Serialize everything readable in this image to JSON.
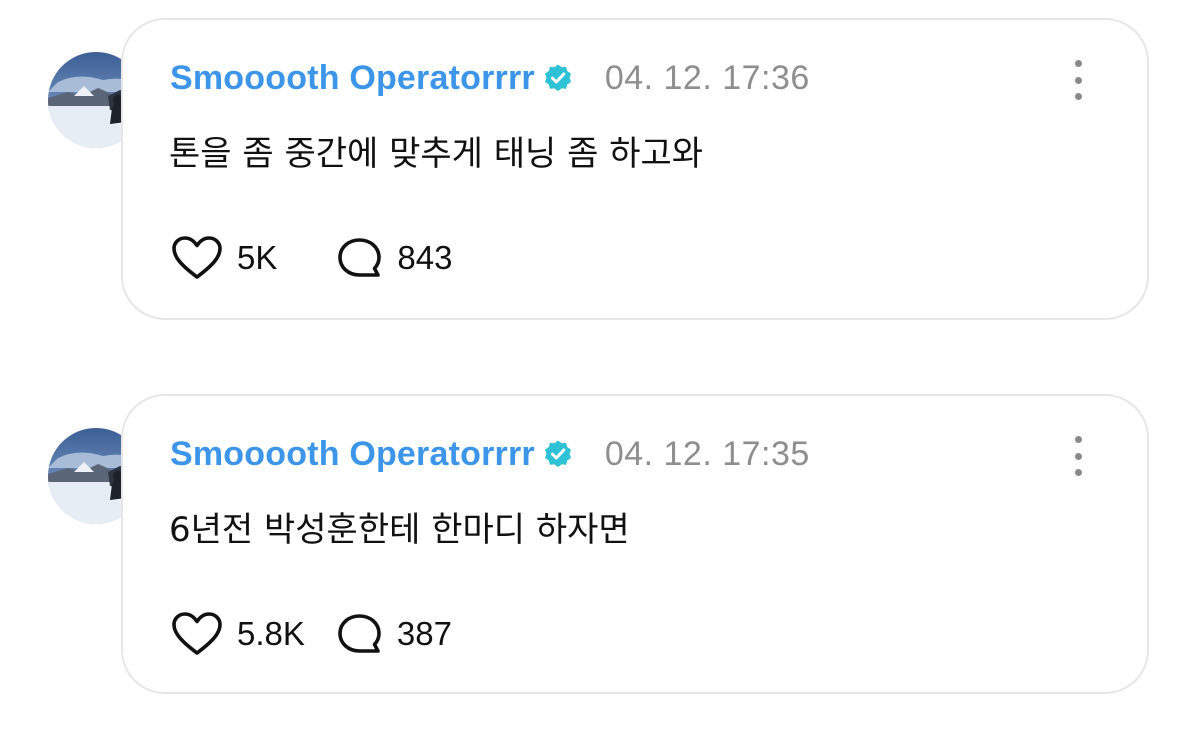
{
  "posts": [
    {
      "author": "Smooooth Operatorrrr",
      "timestamp": "04. 12. 17:36",
      "text": "톤을 좀 중간에 맞추게 태닝 좀 하고와",
      "likes": "5K",
      "comments": "843",
      "verified": true
    },
    {
      "author": "Smooooth Operatorrrr",
      "timestamp": "04. 12. 17:35",
      "text": "6년전 박성훈한테 한마디 하자면",
      "likes": "5.8K",
      "comments": "387",
      "verified": true
    }
  ],
  "icons": {
    "verified": "verified-badge-icon",
    "like": "heart-icon",
    "comment": "speech-bubble-icon",
    "more": "vertical-ellipsis-icon"
  },
  "colors": {
    "author_name": "#3c95e8",
    "verified_badge": "#2fc1d6",
    "timestamp": "#8e8e8e",
    "text": "#111111",
    "card_border": "#e6e6e6"
  }
}
